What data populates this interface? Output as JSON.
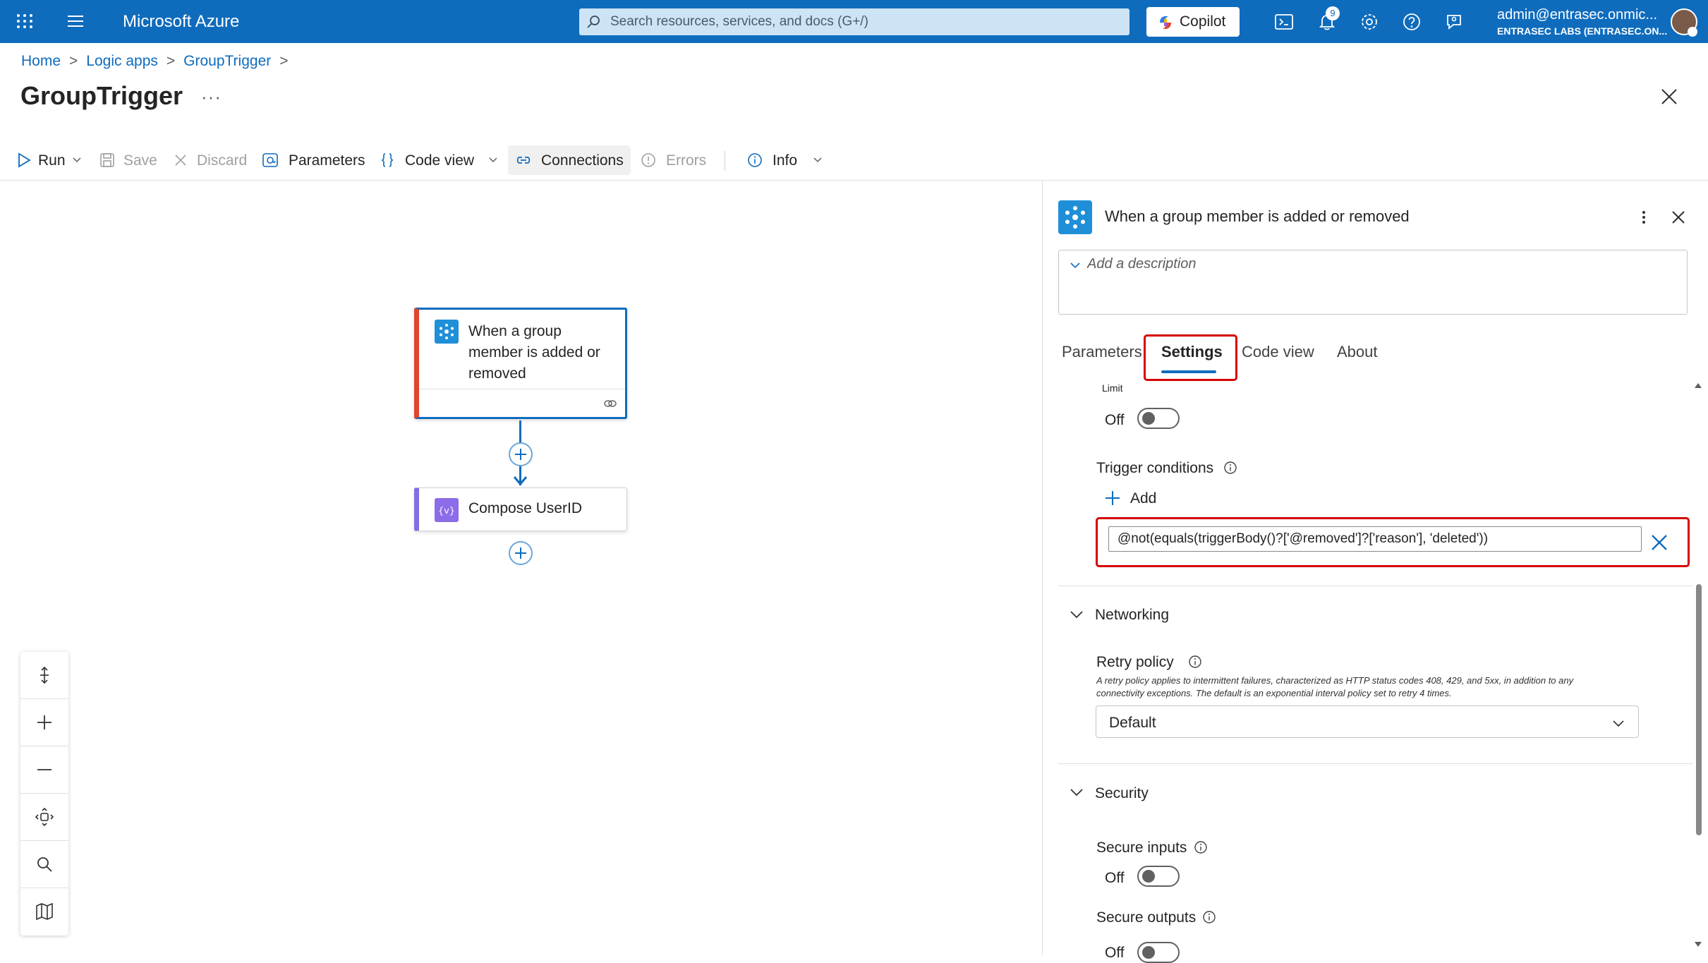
{
  "header": {
    "brand": "Microsoft Azure",
    "search_placeholder": "Search resources, services, and docs (G+/)",
    "copilot_label": "Copilot",
    "notifications_count": "9",
    "account_email": "admin@entrasec.onmic...",
    "account_tenant": "ENTRASEC LABS (ENTRASEC.ON..."
  },
  "breadcrumb": [
    "Home",
    "Logic apps",
    "GroupTrigger"
  ],
  "page": {
    "title": "GroupTrigger",
    "more_label": "···"
  },
  "toolbar": {
    "run": "Run",
    "save": "Save",
    "discard": "Discard",
    "parameters": "Parameters",
    "code_view": "Code view",
    "connections": "Connections",
    "errors": "Errors",
    "info": "Info"
  },
  "canvas": {
    "trigger_node": "When a group member is added or removed",
    "action_node": "Compose UserID"
  },
  "panel": {
    "title": "When a group member is added or removed",
    "description_placeholder": "Add a description",
    "tabs": [
      "Parameters",
      "Settings",
      "Code view",
      "About"
    ],
    "active_tab": "Settings",
    "limit_label": "Limit",
    "limit_state": "Off",
    "trigger_conditions_label": "Trigger conditions",
    "add_label": "Add",
    "condition_value": "@not(equals(triggerBody()?['@removed']?['reason'], 'deleted'))",
    "networking_label": "Networking",
    "retry_policy_label": "Retry policy",
    "retry_policy_desc_1": "A retry policy applies to intermittent failures, characterized as HTTP status codes 408, 429, and 5xx, in addition to any",
    "retry_policy_desc_2": "connectivity exceptions. The default is an exponential interval policy set to retry 4 times.",
    "retry_policy_value": "Default",
    "security_label": "Security",
    "secure_inputs_label": "Secure inputs",
    "secure_inputs_state": "Off",
    "secure_outputs_label": "Secure outputs",
    "secure_outputs_state": "Off"
  },
  "colors": {
    "azure_blue": "#0f6cbd",
    "highlight_red": "#d60000",
    "trigger_accent": "#e0452d",
    "action_accent": "#7f6fe4"
  }
}
